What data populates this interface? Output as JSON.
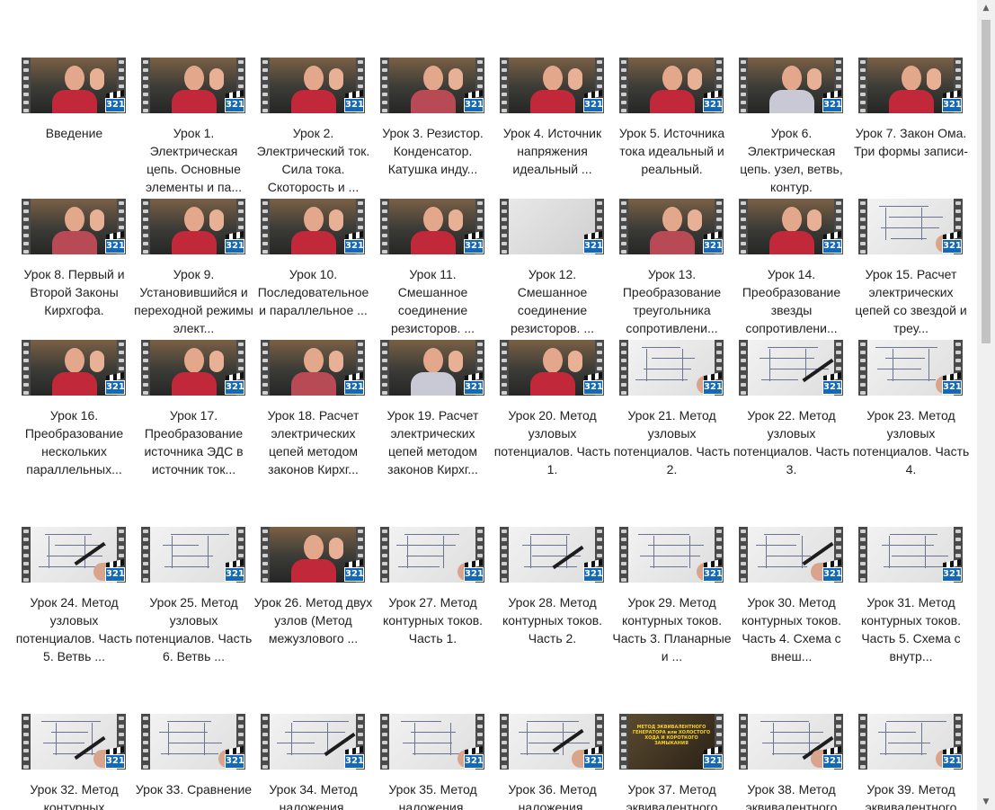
{
  "badge_text": "321",
  "scroll_icons": {
    "up": "▲",
    "down": "▼"
  },
  "videos": [
    {
      "title": "Введение",
      "thumb": "person"
    },
    {
      "title": "Урок 1. Электрическая цепь. Основные элементы и па...",
      "thumb": "person"
    },
    {
      "title": "Урок 2. Электрический ток. Сила тока. Скоторость и ...",
      "thumb": "person"
    },
    {
      "title": "Урок 3. Резистор. Конденсатор. Катушка инду...",
      "thumb": "person"
    },
    {
      "title": "Урок 4. Источник напряжения идеальный ...",
      "thumb": "person"
    },
    {
      "title": "Урок 5. Источника тока идеальный и реальный.",
      "thumb": "person"
    },
    {
      "title": "Урок 6. Электрическая цепь. узел, ветвь, контур.",
      "thumb": "person2"
    },
    {
      "title": "Урок 7. Закон Ома. Три формы записи-",
      "thumb": "person"
    },
    {
      "title": "Урок 8. Первый и Второй Законы Кирхгофа.",
      "thumb": "person"
    },
    {
      "title": "Урок 9. Установившийся и переходной режимы элект...",
      "thumb": "person"
    },
    {
      "title": "Урок 10. Последовательное и параллельное ...",
      "thumb": "person"
    },
    {
      "title": "Урок 11. Смешанное соединение резисторов. ...",
      "thumb": "person"
    },
    {
      "title": "Урок 12. Смешанное соединение резисторов. ...",
      "thumb": "blank"
    },
    {
      "title": "Урок 13. Преобразование треугольника сопротивлени...",
      "thumb": "person"
    },
    {
      "title": "Урок 14. Преобразование звезды сопротивлени...",
      "thumb": "person"
    },
    {
      "title": "Урок 15. Расчет электрических цепей со звездой и треу...",
      "thumb": "board"
    },
    {
      "title": "Урок 16. Преобразование нескольких параллельных...",
      "thumb": "person"
    },
    {
      "title": "Урок 17. Преобразование источника ЭДС в источник ток...",
      "thumb": "person"
    },
    {
      "title": "Урок 18. Расчет электрических цепей методом законов Кирхг...",
      "thumb": "person"
    },
    {
      "title": "Урок 19. Расчет электрических цепей методом законов Кирхг...",
      "thumb": "person2"
    },
    {
      "title": "Урок 20. Метод узловых потенциалов. Часть 1.",
      "thumb": "person"
    },
    {
      "title": "Урок 21. Метод узловых потенциалов. Часть 2.",
      "thumb": "board"
    },
    {
      "title": "Урок 22. Метод узловых потенциалов. Часть 3.",
      "thumb": "board"
    },
    {
      "title": "Урок 23. Метод узловых потенциалов. Часть 4.",
      "thumb": "board"
    },
    {
      "title": "Урок 24. Метод узловых потенциалов. Часть 5. Ветвь ...",
      "thumb": "board"
    },
    {
      "title": "Урок 25. Метод узловых потенциалов. Часть 6. Ветвь ...",
      "thumb": "board"
    },
    {
      "title": "Урок 26. Метод двух узлов (Метод межузлового ...",
      "thumb": "person"
    },
    {
      "title": "Урок 27. Метод контурных токов. Часть 1.",
      "thumb": "board"
    },
    {
      "title": "Урок 28. Метод контурных токов. Часть 2.",
      "thumb": "board"
    },
    {
      "title": "Урок 29. Метод контурных токов. Часть 3. Планарные и ...",
      "thumb": "board"
    },
    {
      "title": "Урок 30. Метод контурных токов. Часть 4. Схема с внеш...",
      "thumb": "board"
    },
    {
      "title": "Урок 31. Метод контурных токов. Часть 5. Схема с внутр...",
      "thumb": "board"
    },
    {
      "title": "Урок 32. Метод контурных",
      "thumb": "board"
    },
    {
      "title": "Урок 33. Сравнение",
      "thumb": "board"
    },
    {
      "title": "Урок 34. Метод наложения.",
      "thumb": "board"
    },
    {
      "title": "Урок 35. Метод наложения.",
      "thumb": "board"
    },
    {
      "title": "Урок 36. Метод наложения.",
      "thumb": "board"
    },
    {
      "title": "Урок 37. Метод эквивалентного",
      "thumb": "title",
      "thumb_text": "МЕТОД ЭКВИВАЛЕНТНОГО ГЕНЕРАТОРА или ХОЛОСТОГО ХОДА И КОРОТКОГО ЗАМЫКАНИЯ"
    },
    {
      "title": "Урок 38. Метод эквивалентного",
      "thumb": "board"
    },
    {
      "title": "Урок 39. Метод эквивалентного",
      "thumb": "board"
    }
  ]
}
